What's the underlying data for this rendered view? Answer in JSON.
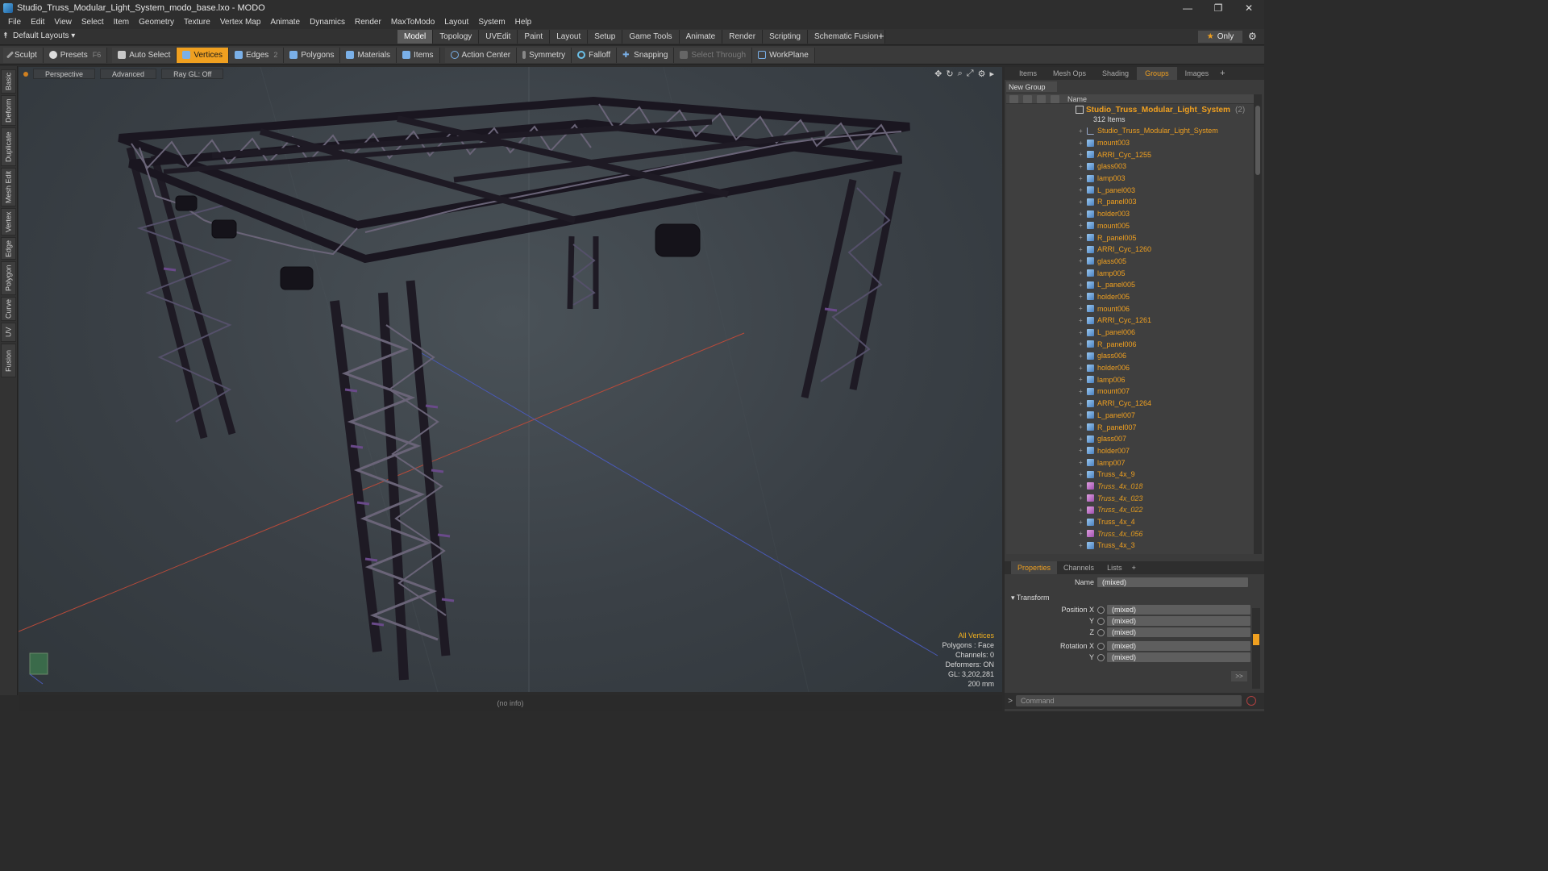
{
  "window": {
    "title": "Studio_Truss_Modular_Light_System_modo_base.lxo - MODO",
    "controls": [
      "—",
      "❐",
      "✕"
    ]
  },
  "menu": [
    "File",
    "Edit",
    "View",
    "Select",
    "Item",
    "Geometry",
    "Texture",
    "Vertex Map",
    "Animate",
    "Dynamics",
    "Render",
    "MaxToModo",
    "Layout",
    "System",
    "Help"
  ],
  "layoutbar": {
    "layout_select": "Default Layouts ▾",
    "tabs": [
      "Model",
      "Topology",
      "UVEdit",
      "Paint",
      "Layout",
      "Setup",
      "Game Tools",
      "Animate",
      "Render",
      "Scripting",
      "Schematic Fusion"
    ],
    "active_tab": "Model",
    "add": "+",
    "only_label": "Only"
  },
  "toolbar": {
    "sculpt": "Sculpt",
    "presets": "Presets",
    "presets_key": "F6",
    "auto_select": "Auto Select",
    "vertices": "Vertices",
    "edges": "Edges",
    "edges_count": "2",
    "polygons": "Polygons",
    "materials": "Materials",
    "items": "Items",
    "action_center": "Action Center",
    "symmetry": "Symmetry",
    "falloff": "Falloff",
    "snapping": "Snapping",
    "select_through": "Select Through",
    "workplane": "WorkPlane"
  },
  "left_tabs": [
    "Basic",
    "Deform",
    "Duplicate",
    "Mesh Edit",
    "Vertex",
    "Edge",
    "Polygon",
    "Curve",
    "UV",
    "Fusion"
  ],
  "viewport": {
    "view_mode": "Perspective",
    "shading": "Advanced",
    "raygl": "Ray GL: Off",
    "info": {
      "selection": "All Vertices",
      "polygons": "Polygons : Face",
      "channels": "Channels: 0",
      "deformers": "Deformers: ON",
      "gl": "GL: 3,202,281",
      "scale": "200 mm"
    }
  },
  "status": "(no info)",
  "right_panel": {
    "tabs": [
      "Items",
      "Mesh Ops",
      "Shading",
      "Groups",
      "Images"
    ],
    "active_tab": "Groups",
    "new_group": "New Group",
    "column_name": "Name",
    "group": {
      "name": "Studio_Truss_Modular_Light_System",
      "count": "(2)",
      "items_label": "312 Items"
    },
    "items": [
      {
        "name": "Studio_Truss_Modular_Light_System",
        "icon": "locator-icon",
        "italic": false
      },
      {
        "name": "mount003",
        "icon": "mesh-icon",
        "italic": false
      },
      {
        "name": "ARRI_Cyc_1255",
        "icon": "mesh-icon",
        "italic": false
      },
      {
        "name": "glass003",
        "icon": "mesh-icon",
        "italic": false
      },
      {
        "name": "lamp003",
        "icon": "mesh-icon",
        "italic": false
      },
      {
        "name": "L_panel003",
        "icon": "mesh-icon",
        "italic": false
      },
      {
        "name": "R_panel003",
        "icon": "mesh-icon",
        "italic": false
      },
      {
        "name": "holder003",
        "icon": "mesh-icon",
        "italic": false
      },
      {
        "name": "mount005",
        "icon": "mesh-icon",
        "italic": false
      },
      {
        "name": "R_panel005",
        "icon": "mesh-icon",
        "italic": false
      },
      {
        "name": "ARRI_Cyc_1260",
        "icon": "mesh-icon",
        "italic": false
      },
      {
        "name": "glass005",
        "icon": "mesh-icon",
        "italic": false
      },
      {
        "name": "lamp005",
        "icon": "mesh-icon",
        "italic": false
      },
      {
        "name": "L_panel005",
        "icon": "mesh-icon",
        "italic": false
      },
      {
        "name": "holder005",
        "icon": "mesh-icon",
        "italic": false
      },
      {
        "name": "mount006",
        "icon": "mesh-icon",
        "italic": false
      },
      {
        "name": "ARRI_Cyc_1261",
        "icon": "mesh-icon",
        "italic": false
      },
      {
        "name": "L_panel006",
        "icon": "mesh-icon",
        "italic": false
      },
      {
        "name": "R_panel006",
        "icon": "mesh-icon",
        "italic": false
      },
      {
        "name": "glass006",
        "icon": "mesh-icon",
        "italic": false
      },
      {
        "name": "holder006",
        "icon": "mesh-icon",
        "italic": false
      },
      {
        "name": "lamp006",
        "icon": "mesh-icon",
        "italic": false
      },
      {
        "name": "mount007",
        "icon": "mesh-icon",
        "italic": false
      },
      {
        "name": "ARRI_Cyc_1264",
        "icon": "mesh-icon",
        "italic": false
      },
      {
        "name": "L_panel007",
        "icon": "mesh-icon",
        "italic": false
      },
      {
        "name": "R_panel007",
        "icon": "mesh-icon",
        "italic": false
      },
      {
        "name": "glass007",
        "icon": "mesh-icon",
        "italic": false
      },
      {
        "name": "holder007",
        "icon": "mesh-icon",
        "italic": false
      },
      {
        "name": "lamp007",
        "icon": "mesh-icon",
        "italic": false
      },
      {
        "name": "Truss_4x_9",
        "icon": "mesh-icon",
        "italic": false
      },
      {
        "name": "Truss_4x_018",
        "icon": "instance-icon",
        "italic": true
      },
      {
        "name": "Truss_4x_023",
        "icon": "instance-icon",
        "italic": true
      },
      {
        "name": "Truss_4x_022",
        "icon": "instance-icon",
        "italic": true
      },
      {
        "name": "Truss_4x_4",
        "icon": "mesh-icon",
        "italic": false
      },
      {
        "name": "Truss_4x_056",
        "icon": "instance-icon",
        "italic": true
      },
      {
        "name": "Truss_4x_3",
        "icon": "mesh-icon",
        "italic": false
      }
    ],
    "props_tabs": [
      "Properties",
      "Channels",
      "Lists"
    ],
    "props_active": "Properties",
    "properties": {
      "name_label": "Name",
      "name_value": "(mixed)",
      "transform_label": "Transform",
      "position_x_label": "Position X",
      "position_x": "(mixed)",
      "position_y_label": "Y",
      "position_y": "(mixed)",
      "position_z_label": "Z",
      "position_z": "(mixed)",
      "rotation_x_label": "Rotation X",
      "rotation_x": "(mixed)",
      "rotation_y_label": "Y",
      "rotation_y": "(mixed)",
      "more": ">>"
    },
    "command_placeholder": "Command"
  },
  "colors": {
    "accent": "#f0a020",
    "viewport_bg": "#3a4046",
    "truss": "#2a2530",
    "truss_accent": "#6a4a8a"
  }
}
